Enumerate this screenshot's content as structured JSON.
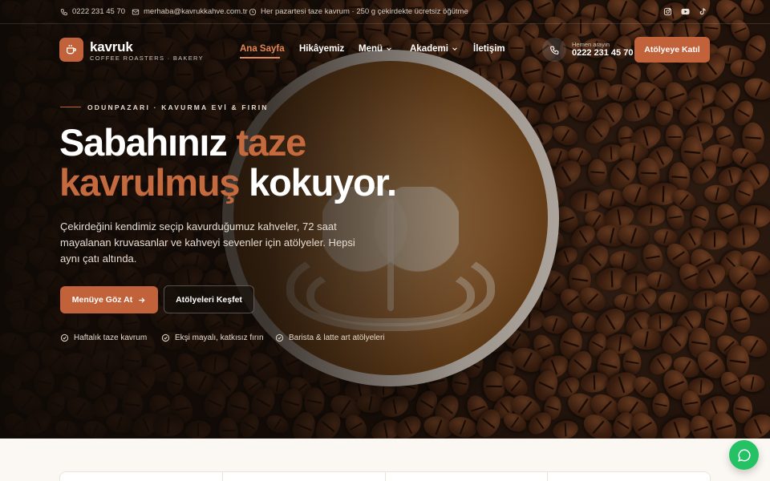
{
  "topbar": {
    "phone": "0222 231 45 70",
    "email": "merhaba@kavrukkahve.com.tr",
    "notice": "Her pazartesi taze kavrum · 250 g çekirdekte ücretsiz öğütme",
    "socials": [
      "instagram-icon",
      "youtube-icon",
      "tiktok-icon"
    ]
  },
  "brand": {
    "name": "kavruk",
    "tagline": "COFFEE ROASTERS · BAKERY"
  },
  "nav": {
    "items": [
      {
        "label": "Ana Sayfa",
        "active": true,
        "dropdown": false
      },
      {
        "label": "Hikâyemiz",
        "active": false,
        "dropdown": false
      },
      {
        "label": "Menü",
        "active": false,
        "dropdown": true
      },
      {
        "label": "Akademi",
        "active": false,
        "dropdown": true
      },
      {
        "label": "İletişim",
        "active": false,
        "dropdown": false
      }
    ]
  },
  "header_contact": {
    "caption": "Hemen arayın",
    "phone": "0222 231 45 70"
  },
  "header_cta": "Atölyeye Katıl",
  "hero": {
    "eyebrow": "ODUNPAZARI · KAVURMA EVİ & FIRIN",
    "headline_part1": "Sabahınız ",
    "headline_accent1": "taze",
    "headline_accent2": "kavrulmuş",
    "headline_part2": " kokuyor.",
    "lead": "Çekirdeğini kendimiz seçip kavurduğumuz kahveler, 72 saat mayalanan kruvasanlar ve kahveyi sevenler için atölyeler. Hepsi aynı çatı altında.",
    "primary_button": "Menüye Göz At",
    "secondary_button": "Atölyeleri Keşfet",
    "features": [
      "Haftalık taze kavrum",
      "Ekşi mayalı, katkısız fırın",
      "Barista & latte art atölyeleri"
    ]
  },
  "colors": {
    "accent": "#c2623a",
    "nav_active": "#e08658",
    "chat": "#25c265"
  }
}
